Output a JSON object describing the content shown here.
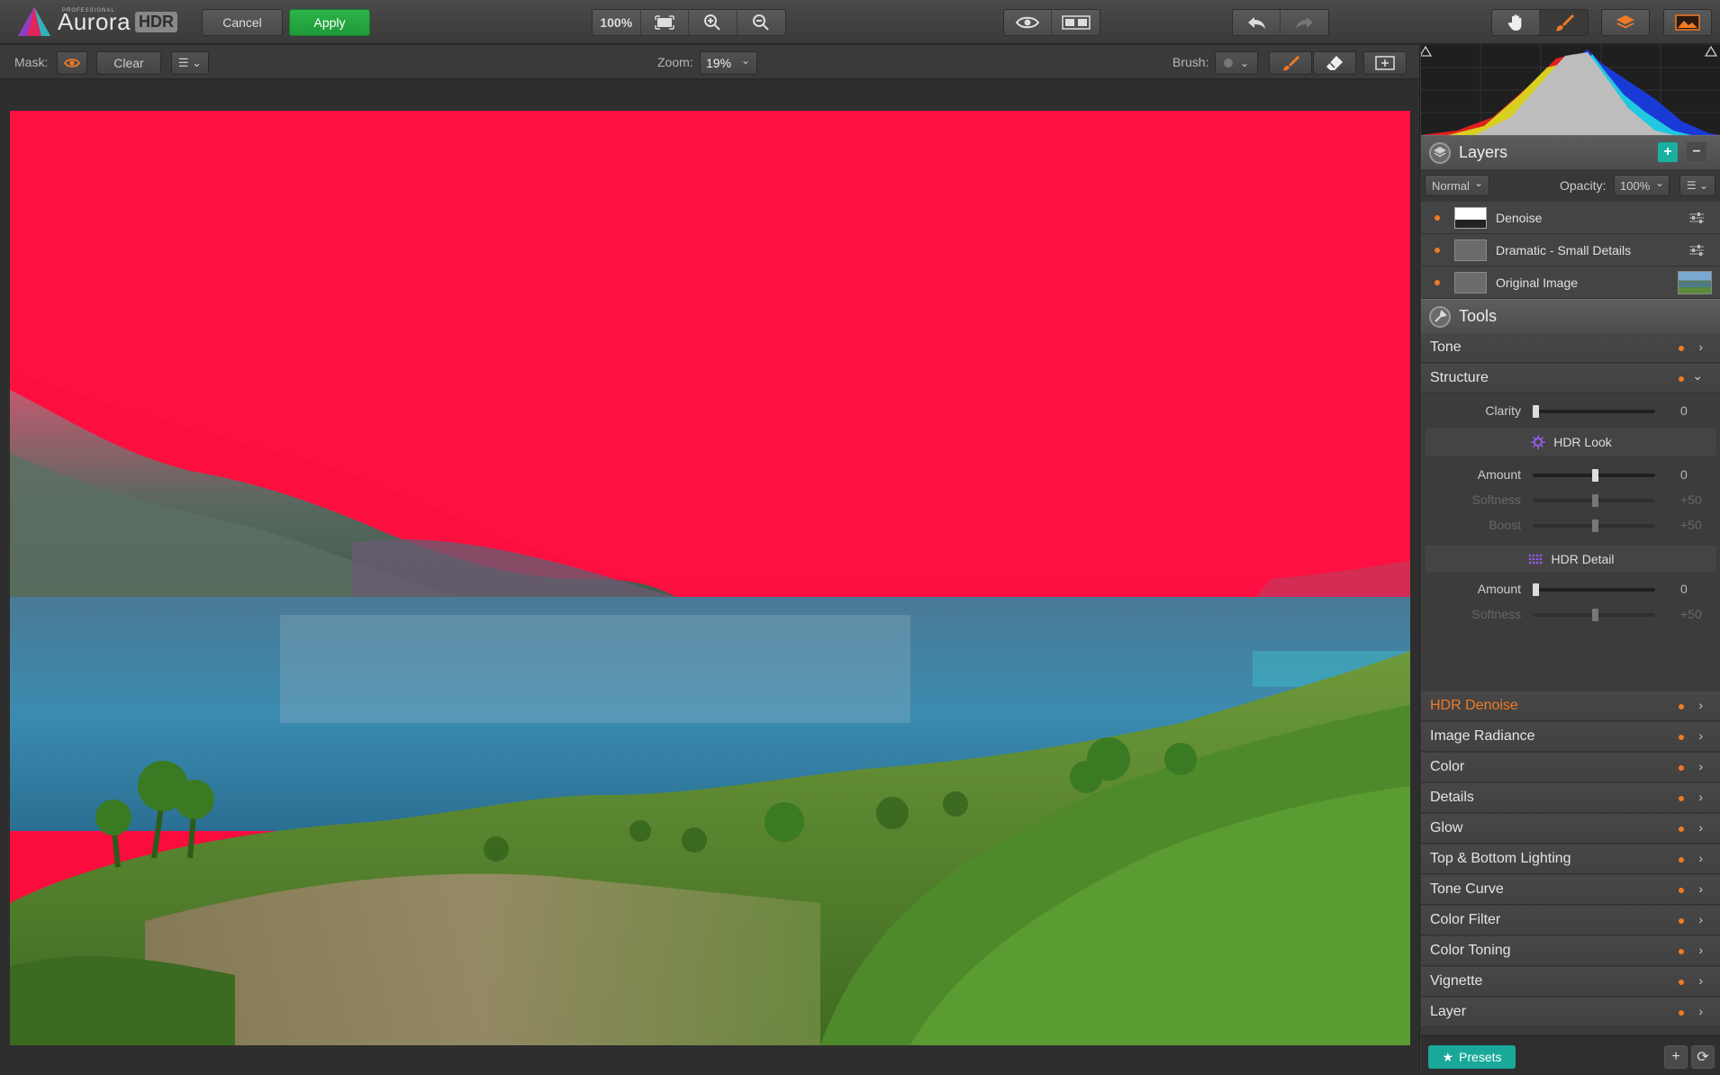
{
  "app": {
    "name": "Aurora",
    "badge": "HDR",
    "edition": "PROFESSIONAL"
  },
  "toolbar": {
    "cancel_label": "Cancel",
    "apply_label": "Apply",
    "zoom_100_label": "100%",
    "icons": [
      "fit-screen-icon",
      "zoom-in-icon",
      "zoom-out-icon",
      "eye-preview-icon",
      "compare-icon",
      "undo-icon",
      "redo-icon",
      "hand-tool-icon",
      "brush-tool-icon",
      "layers-icon",
      "image-icon"
    ]
  },
  "maskbar": {
    "mask_label": "Mask:",
    "clear_label": "Clear",
    "zoom_label": "Zoom:",
    "zoom_value": "19%",
    "brush_label": "Brush:"
  },
  "layers": {
    "title": "Layers",
    "blend_mode": "Normal",
    "opacity_label": "Opacity:",
    "opacity_value": "100%",
    "items": [
      {
        "name": "Denoise"
      },
      {
        "name": "Dramatic - Small Details"
      },
      {
        "name": "Original Image"
      }
    ]
  },
  "tools": {
    "title": "Tools",
    "tone": "Tone",
    "structure": "Structure",
    "clarity": {
      "label": "Clarity",
      "value": "0"
    },
    "hdr_look": {
      "title": "HDR Look",
      "amount": {
        "label": "Amount",
        "value": "0"
      },
      "softness": {
        "label": "Softness",
        "value": "+50"
      },
      "boost": {
        "label": "Boost",
        "value": "+50"
      }
    },
    "hdr_detail": {
      "title": "HDR Detail",
      "amount": {
        "label": "Amount",
        "value": "0"
      },
      "softness": {
        "label": "Softness",
        "value": "+50"
      }
    },
    "list": [
      "HDR Denoise",
      "Image Radiance",
      "Color",
      "Details",
      "Glow",
      "Top & Bottom Lighting",
      "Tone Curve",
      "Color Filter",
      "Color Toning",
      "Vignette",
      "Layer"
    ]
  },
  "footer": {
    "presets_label": "Presets"
  },
  "colors": {
    "accent_orange": "#f07a24",
    "apply_green": "#22a83e",
    "teal": "#19a89a",
    "mask_red": "#ff1744"
  }
}
